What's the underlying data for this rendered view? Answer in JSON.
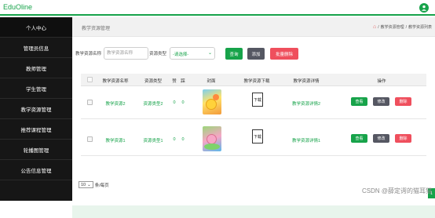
{
  "app": {
    "brand": "EduOline"
  },
  "sidebar": {
    "items": [
      {
        "label": "个人中心"
      },
      {
        "label": "管理员信息"
      },
      {
        "label": "教师管理"
      },
      {
        "label": "学生管理"
      },
      {
        "label": "教学资源管理"
      },
      {
        "label": "推荐课程管理"
      },
      {
        "label": "轮播图管理"
      },
      {
        "label": "公告信息管理"
      }
    ]
  },
  "header": {
    "page_title": "教学资源管理",
    "breadcrumb": [
      "教学资源管理",
      "教学资源列表"
    ]
  },
  "search": {
    "name_label": "教学资源名称",
    "name_placeholder": "教学资源名称",
    "type_label": "资源类型",
    "type_selected": "-请选择-",
    "query_button": "查询",
    "add_button": "添加",
    "batch_delete_button": "批量删除"
  },
  "table": {
    "columns": [
      "教学资源名称",
      "资源类型",
      "赞",
      "踩",
      "封面",
      "教学资源下载",
      "教学资源详情",
      "操作"
    ],
    "rows": [
      {
        "name": "教学资源2",
        "type": "资源类型2",
        "likes": "0",
        "dislikes": "0",
        "download": "下载",
        "detail": "教学资源详情2"
      },
      {
        "name": "教学资源1",
        "type": "资源类型1",
        "likes": "0",
        "dislikes": "0",
        "download": "下载",
        "detail": "教学资源详情1"
      }
    ],
    "actions": {
      "view": "查看",
      "edit": "修改",
      "delete": "删除"
    }
  },
  "pagination": {
    "page_size": "10",
    "suffix": "条/每页",
    "current_page": "1"
  },
  "watermark": "CSDN @薛定谔的猫耳猫",
  "colors": {
    "accent": "#17a34a",
    "danger": "#ef4f5d",
    "neutral_button": "#555762",
    "sidebar": "#161616"
  }
}
